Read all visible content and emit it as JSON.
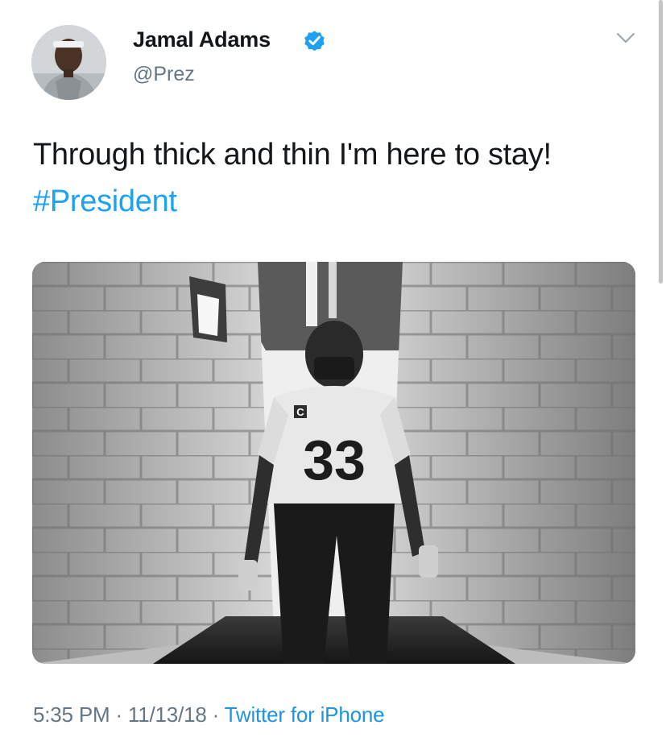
{
  "tweet": {
    "author": {
      "display_name": "Jamal Adams",
      "handle": "@Prez",
      "verified": true,
      "verified_icon": "verified-badge-icon",
      "verified_color": "#1da1f2"
    },
    "text_plain": "Through thick and thin I'm here to stay!",
    "hashtag": "#President",
    "media": {
      "jersey_number": "33",
      "captain_patch": "C"
    },
    "timestamp": "5:35 PM · 11/13/18 ·",
    "source": "Twitter for iPhone"
  },
  "colors": {
    "text": "#14171a",
    "secondary": "#657786",
    "link": "#1b95e0",
    "hashtag": "#1da1f2"
  },
  "icons": {
    "menu": "chevron-down-icon"
  }
}
